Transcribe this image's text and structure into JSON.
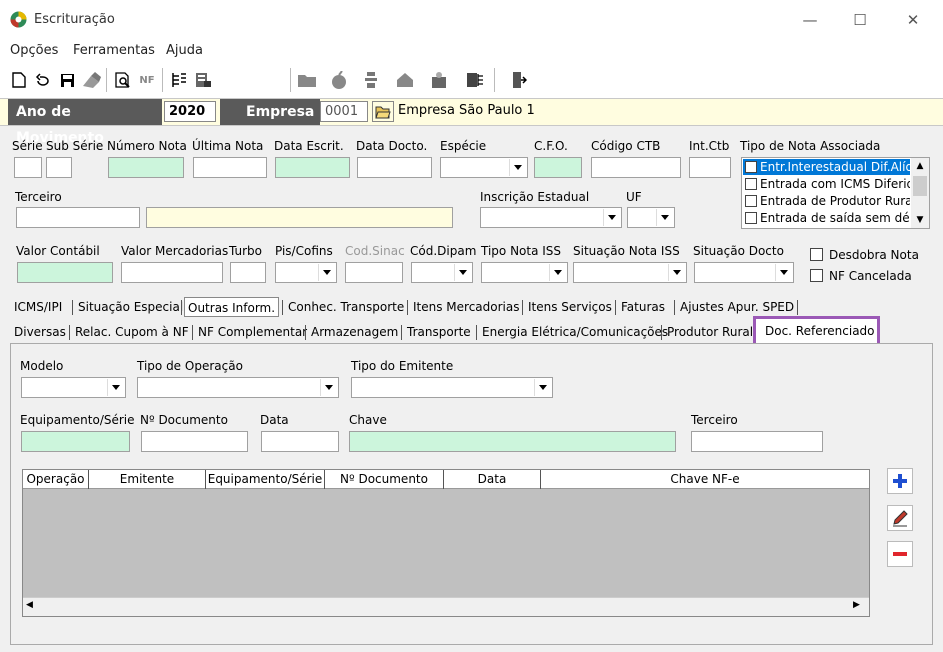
{
  "window": {
    "title": "Escrituração",
    "minimize": "—",
    "maximize": "☐",
    "close": "✕"
  },
  "menu": [
    "Opções",
    "Ferramentas",
    "Ajuda"
  ],
  "header": {
    "ano_label": "Ano de Movimento",
    "ano_value": "2020",
    "empresa_label": "Empresa",
    "empresa_code": "0001",
    "empresa_name": "Empresa São Paulo  1"
  },
  "labels": {
    "serie": "Série",
    "sub_serie": "Sub Série",
    "numero_nota": "Número Nota",
    "ultima_nota": "Última Nota",
    "data_escrit": "Data Escrit.",
    "data_docto": "Data Docto.",
    "especie": "Espécie",
    "cfo": "C.F.O.",
    "codigo_ctb": "Código CTB",
    "int_ctb": "Int.Ctb",
    "tipo_nota_associada": "Tipo de Nota Associada",
    "terceiro": "Terceiro",
    "inscricao_estadual": "Inscrição Estadual",
    "uf": "UF",
    "valor_contabil": "Valor Contábil",
    "valor_mercadorias": "Valor Mercadorias",
    "turbo": "Turbo",
    "pis_cofins": "Pis/Cofins",
    "cod_sinac": "Cod.Sinac",
    "cod_dipam": "Cód.Dipam",
    "tipo_nota_iss": "Tipo Nota ISS",
    "situacao_nota_iss": "Situação Nota ISS",
    "situacao_docto": "Situação Docto",
    "desdobra_nota": "Desdobra Nota",
    "nf_cancelada": "NF Cancelada"
  },
  "tipo_nota_options": [
    "Entr.Interestadual Dif.Alíq",
    "Entrada com ICMS Diferido",
    "Entrada de Produtor Rural",
    "Entrada de saída sem débi"
  ],
  "tabs_row1": [
    "ICMS/IPI",
    "Situação Especial",
    "Outras Inform.",
    "Conhec. Transporte",
    "Itens Mercadorias",
    "Itens Serviços",
    "Faturas",
    "Ajustes Apur. SPED"
  ],
  "tabs_row2": [
    "Diversas",
    "Relac. Cupom à NF",
    "NF Complementar",
    "Armazenagem",
    "Transporte",
    "Energia Elétrica/Comunicações",
    "Produtor Rural",
    "Doc. Referenciado"
  ],
  "panel": {
    "modelo": "Modelo",
    "tipo_operacao": "Tipo de Operação",
    "tipo_emitente": "Tipo do Emitente",
    "equip_serie": "Equipamento/Série",
    "num_documento": "Nº Documento",
    "data": "Data",
    "chave": "Chave",
    "terceiro": "Terceiro"
  },
  "grid_columns": [
    "Operação",
    "Emitente",
    "Equipamento/Série",
    "Nº Documento",
    "Data",
    "Chave NF-e"
  ],
  "colors": {
    "highlight": "#9b59b6",
    "green_field": "#ccf5dc",
    "yellow_field": "#fffde0",
    "selection": "#0078d7"
  }
}
